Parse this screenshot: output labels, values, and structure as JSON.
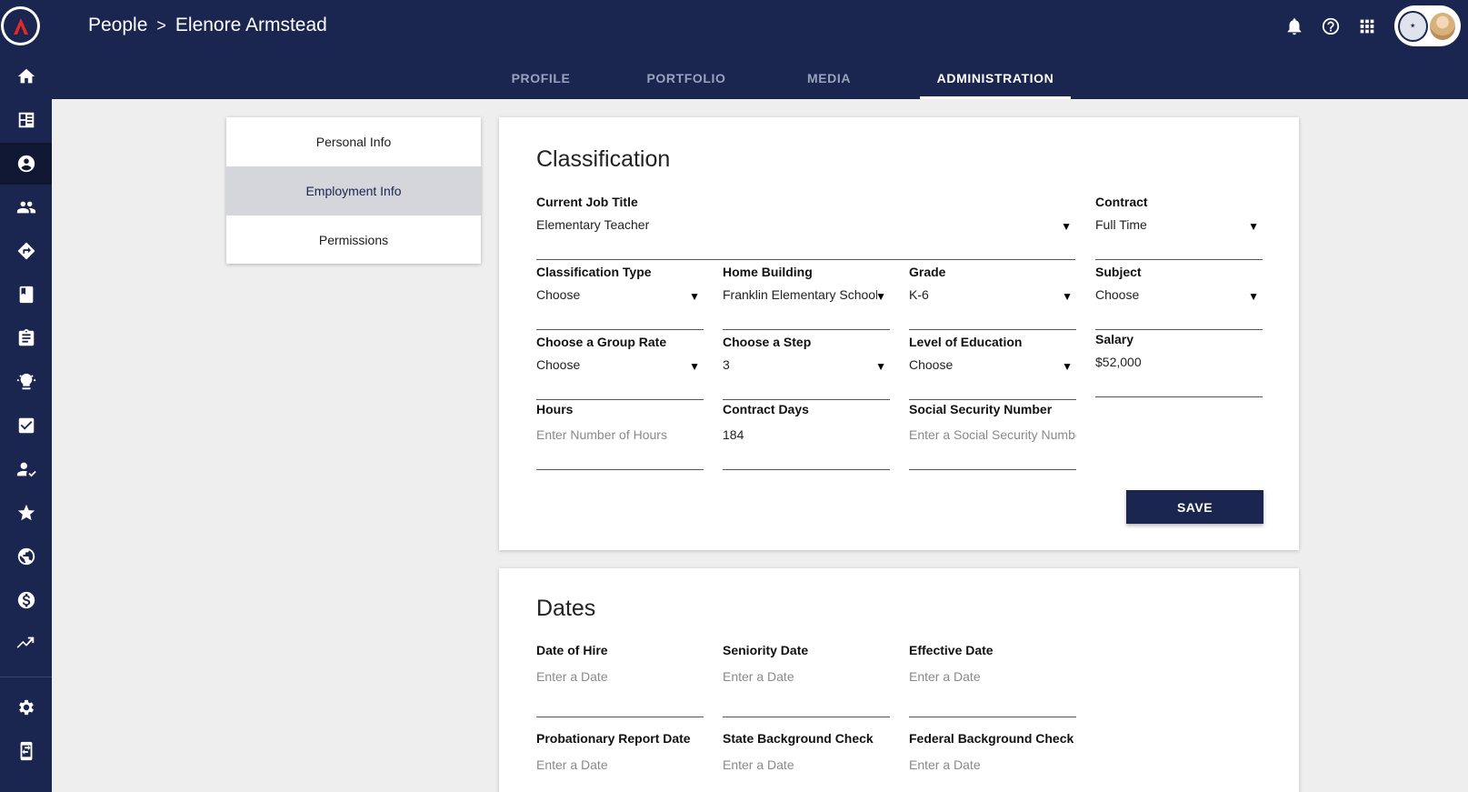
{
  "breadcrumb": {
    "root": "People",
    "separator": ">",
    "current": "Elenore Armstead"
  },
  "tabs": [
    "PROFILE",
    "PORTFOLIO",
    "MEDIA",
    "ADMINISTRATION"
  ],
  "active_tab": "ADMINISTRATION",
  "side_menu": [
    "Personal Info",
    "Employment Info",
    "Permissions"
  ],
  "active_side_menu": "Employment Info",
  "rail_icons": [
    "home-icon",
    "dashboard-icon",
    "account-circle-icon",
    "people-icon",
    "directions-icon",
    "book-icon",
    "assignment-icon",
    "lightbulb-icon",
    "checkbox-icon",
    "person-check-icon",
    "star-icon",
    "globe-icon",
    "dollar-icon",
    "trending-icon",
    "settings-icon",
    "mobile-icon"
  ],
  "top_icons": [
    "bell-icon",
    "help-icon",
    "apps-grid-icon"
  ],
  "classification": {
    "title": "Classification",
    "current_job_title": {
      "label": "Current Job Title",
      "value": "Elementary Teacher"
    },
    "contract": {
      "label": "Contract",
      "value": "Full Time"
    },
    "classification_type": {
      "label": "Classification Type",
      "value": "Choose"
    },
    "home_building": {
      "label": "Home Building",
      "value": "Franklin Elementary School"
    },
    "grade": {
      "label": "Grade",
      "value": "K-6"
    },
    "subject": {
      "label": "Subject",
      "value": "Choose"
    },
    "group_rate": {
      "label": "Choose a Group Rate",
      "value": "Choose"
    },
    "step": {
      "label": "Choose a Step",
      "value": "3"
    },
    "education": {
      "label": "Level of Education",
      "value": "Choose"
    },
    "salary": {
      "label": "Salary",
      "value": "$52,000"
    },
    "hours": {
      "label": "Hours",
      "placeholder": "Enter Number of Hours"
    },
    "contract_days": {
      "label": "Contract Days",
      "value": "184"
    },
    "ssn": {
      "label": "Social Security Number",
      "placeholder": "Enter a Social Security Number"
    },
    "save_label": "SAVE"
  },
  "dates": {
    "title": "Dates",
    "date_of_hire": {
      "label": "Date of Hire",
      "placeholder": "Enter a Date"
    },
    "seniority_date": {
      "label": "Seniority Date",
      "placeholder": "Enter a Date"
    },
    "effective_date": {
      "label": "Effective Date",
      "placeholder": "Enter a Date"
    },
    "probationary_report_date": {
      "label": "Probationary Report Date",
      "placeholder": "Enter a Date"
    },
    "state_background_check": {
      "label": "State Background Check",
      "placeholder": "Enter a Date"
    },
    "federal_background_check": {
      "label": "Federal Background Check",
      "placeholder": "Enter a Date"
    }
  },
  "colors": {
    "navy": "#1a2550",
    "background": "#eeeeee",
    "menu_active": "#d4d6dc"
  }
}
